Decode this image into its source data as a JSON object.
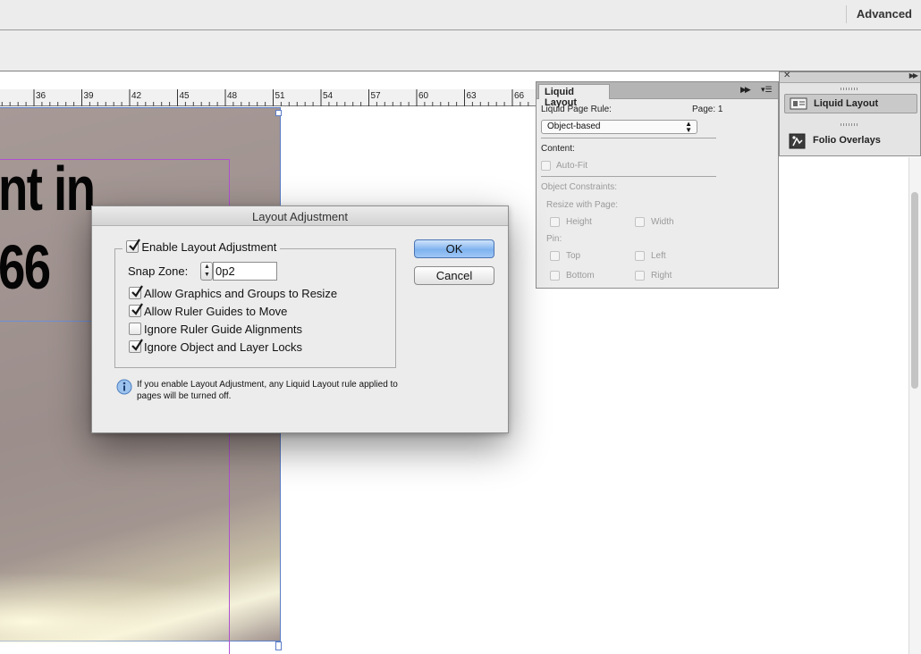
{
  "topbar": {
    "workspace": "Advanced"
  },
  "ruler": {
    "labels": [
      "36",
      "39",
      "42",
      "45",
      "48",
      "51",
      "54",
      "57",
      "60",
      "63",
      "66"
    ]
  },
  "document": {
    "line1": "nt in",
    "line2": "66"
  },
  "liquid_layout_panel": {
    "tab": "Liquid Layout",
    "page_rule_label": "Liquid Page Rule:",
    "page_label": "Page: 1",
    "page_rule_value": "Object-based",
    "content_label": "Content:",
    "auto_fit": "Auto-Fit",
    "object_constraints": "Object Constraints:",
    "resize_with_page": "Resize with Page:",
    "height": "Height",
    "width": "Width",
    "pin": "Pin:",
    "top": "Top",
    "left": "Left",
    "bottom": "Bottom",
    "right": "Right"
  },
  "dock": {
    "items": [
      {
        "label": "Liquid Layout",
        "icon": "liquid-layout-icon"
      },
      {
        "label": "Folio Overlays",
        "icon": "folio-overlays-icon"
      }
    ]
  },
  "dialog": {
    "title": "Layout Adjustment",
    "enable_label": "Enable Layout Adjustment",
    "snap_zone_label": "Snap Zone:",
    "snap_zone_value": "0p2",
    "options": [
      {
        "label": "Allow Graphics and Groups to Resize",
        "checked": true
      },
      {
        "label": "Allow Ruler Guides to Move",
        "checked": true
      },
      {
        "label": "Ignore Ruler Guide Alignments",
        "checked": false
      },
      {
        "label": "Ignore Object and Layer Locks",
        "checked": true
      }
    ],
    "ok": "OK",
    "cancel": "Cancel",
    "info": "If you enable Layout Adjustment, any Liquid Layout rule applied to pages will be turned off."
  },
  "colors": {
    "accent": "#7fb3ef",
    "guide": "#b04fd2",
    "frame": "#5b7dc6"
  }
}
